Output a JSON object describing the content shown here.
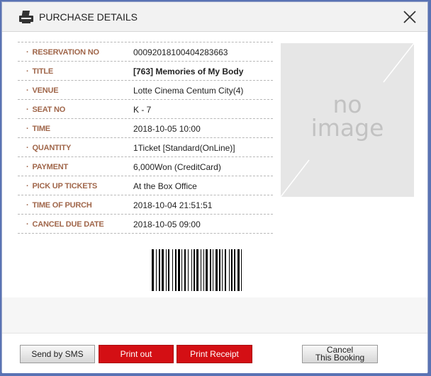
{
  "header": {
    "title": "PURCHASE DETAILS"
  },
  "details": [
    {
      "label": "RESERVATION NO",
      "value": "00092018100404283663",
      "bold": false
    },
    {
      "label": "TITLE",
      "value": "[763] Memories of My Body",
      "bold": true
    },
    {
      "label": "VENUE",
      "value": "Lotte Cinema Centum City(4)",
      "bold": false
    },
    {
      "label": "SEAT NO",
      "value": "K - 7",
      "bold": false
    },
    {
      "label": "TIME",
      "value": "2018-10-05 10:00",
      "bold": false
    },
    {
      "label": "QUANTITY",
      "value": "1Ticket [Standard(OnLine)]",
      "bold": false
    },
    {
      "label": "PAYMENT",
      "value": "6,000Won (CreditCard)",
      "bold": false
    },
    {
      "label": "PICK UP TICKETS",
      "value": "At the Box Office",
      "bold": false
    },
    {
      "label": "TIME OF PURCH",
      "value": "2018-10-04 21:51:51",
      "bold": false
    },
    {
      "label": "CANCEL DUE DATE",
      "value": "2018-10-05 09:00",
      "bold": false
    }
  ],
  "poster": {
    "line1": "no",
    "line2": "image"
  },
  "buttons": {
    "sms": "Send by SMS",
    "print_out": "Print out",
    "print_receipt": "Print Receipt",
    "cancel_line1": "Cancel",
    "cancel_line2": "This Booking"
  },
  "colors": {
    "label": "#a0664a",
    "red_button": "#d40f14"
  }
}
